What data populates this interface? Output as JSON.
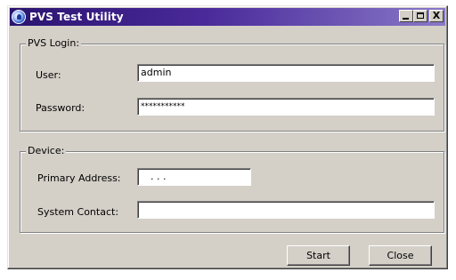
{
  "window": {
    "title": "PVS Test Utility",
    "minimize_glyph": "_",
    "maximize_glyph": "□",
    "close_glyph": "X"
  },
  "pvs_login": {
    "legend": "PVS Login:",
    "user_label": "User:",
    "user_value": "admin",
    "password_label": "Password:",
    "password_value": "***********"
  },
  "device": {
    "legend": "Device:",
    "primary_address_label": "Primary Address:",
    "primary_address_value": ".   .   .",
    "system_contact_label": "System Contact:",
    "system_contact_value": ""
  },
  "buttons": {
    "start_label": "Start",
    "close_label": "Close"
  },
  "colors": {
    "title_gradient_start": "#2a1470",
    "title_gradient_end": "#8878c8",
    "dialog_face": "#d4d0c8"
  }
}
